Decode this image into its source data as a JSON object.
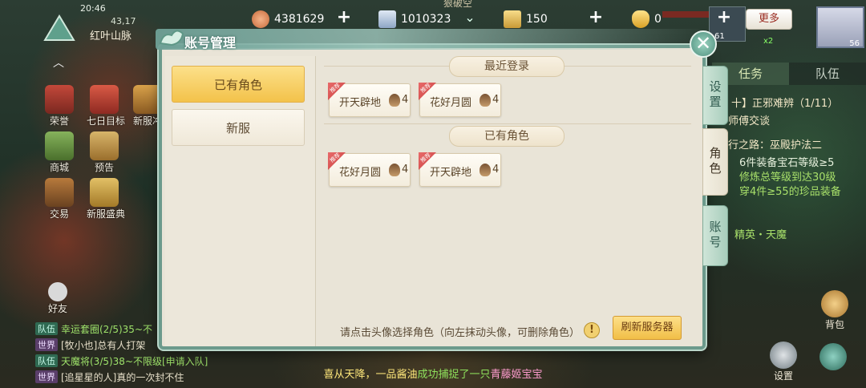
{
  "status": {
    "time": "20:46",
    "coord": "43,17",
    "location": "红叶山脉",
    "boss_top": "狠破空"
  },
  "resources": {
    "jade": "4381629",
    "silver": "1010323",
    "scroll": "150",
    "ingot": "0",
    "more_label": "更多"
  },
  "portraits": {
    "pet_level": "61",
    "player_level": "56",
    "multiplier": "x2"
  },
  "side_menu": [
    {
      "label": "荣誉"
    },
    {
      "label": "七日目标"
    },
    {
      "label": "新服冲"
    },
    {
      "label": "商城"
    },
    {
      "label": "预告"
    },
    {
      "label": "交易"
    },
    {
      "label": "新服盛典"
    }
  ],
  "friends_label": "好友",
  "quest": {
    "tab_task": "任务",
    "tab_team": "队伍",
    "lines": [
      "十】正邪难辨（1/11）",
      "师傅交谈",
      "行之路：巫殿护法二",
      "6件装备宝石等级≥5",
      "修炼总等级到达30级",
      "穿4件≥55的珍品装备",
      "精英・天魔"
    ]
  },
  "dialog": {
    "title": "账号管理",
    "close": "✕",
    "left_buttons": [
      "已有角色",
      "新服"
    ],
    "sections": [
      {
        "header": "最近登录",
        "servers": [
          {
            "name": "开天辟地",
            "count": "4",
            "badge": "推荐"
          },
          {
            "name": "花好月圆",
            "count": "4",
            "badge": "推荐"
          }
        ]
      },
      {
        "header": "已有角色",
        "servers": [
          {
            "name": "花好月圆",
            "count": "4",
            "badge": "推荐"
          },
          {
            "name": "开天辟地",
            "count": "4",
            "badge": "推荐"
          }
        ]
      }
    ],
    "hint": "请点击头像选择角色（向左抹动头像，可删除角色）",
    "warn": "!",
    "refresh_label": "刷新服务器",
    "side_tabs": [
      "设置",
      "角色",
      "账号"
    ]
  },
  "chat": [
    {
      "channel": "队伍",
      "text": "幸运套圈(2/5)35~不"
    },
    {
      "channel": "世界",
      "text": "[牧小也]总有人打架"
    },
    {
      "channel": "队伍",
      "text": "天魔将(3/5)38~不限级[申请入队]"
    },
    {
      "channel": "世界",
      "text": "[追星星的人]真的一次封不住"
    }
  ],
  "broadcast": {
    "part1": "喜从天降，一品酱油",
    "part2": "成功捕捉了一只",
    "part3": "青藤姬宝宝"
  },
  "bottom_right": {
    "bag": "背包",
    "settings": "设置"
  },
  "colors": {
    "dialog_border": "#6c9a8c",
    "selected_gold": "#f3c24a",
    "dialog_bg": "#e9e4d7"
  }
}
